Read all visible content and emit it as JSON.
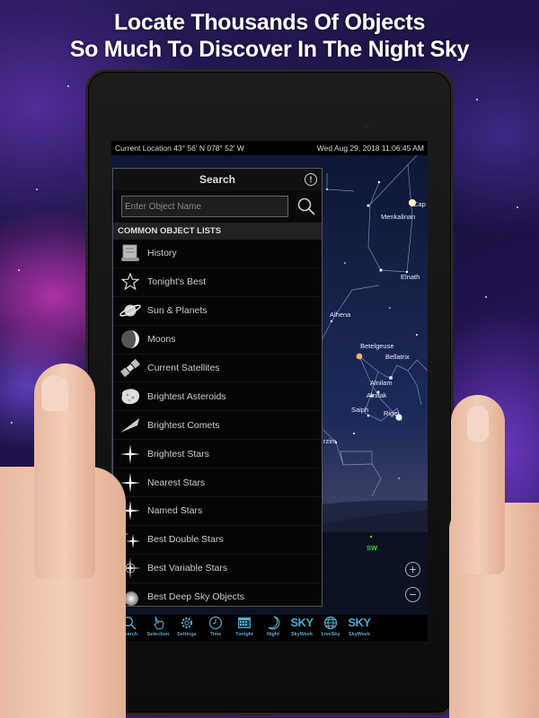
{
  "headline": {
    "line1": "Locate Thousands Of Objects",
    "line2": "So Much To Discover In The Night Sky"
  },
  "statusbar": {
    "location": "Current Location  43° 56' N 078° 52' W",
    "datetime": "Wed Aug 29, 2018  11:06:45 AM"
  },
  "search_panel": {
    "title": "Search",
    "info_icon": "info-icon",
    "input_placeholder": "Enter Object Name",
    "input_value": "",
    "search_icon": "search-icon",
    "section_title": "COMMON OBJECT LISTS",
    "items": [
      {
        "label": "History",
        "icon": "scroll-icon"
      },
      {
        "label": "Tonight's Best",
        "icon": "star-outline-icon"
      },
      {
        "label": "Sun & Planets",
        "icon": "planet-icon"
      },
      {
        "label": "Moons",
        "icon": "moon-icon"
      },
      {
        "label": "Current Satellites",
        "icon": "satellite-icon"
      },
      {
        "label": "Brightest Asteroids",
        "icon": "asteroid-icon"
      },
      {
        "label": "Brightest Comets",
        "icon": "comet-icon"
      },
      {
        "label": "Brightest Stars",
        "icon": "sparkle-star-icon"
      },
      {
        "label": "Nearest Stars",
        "icon": "sparkle-star-icon"
      },
      {
        "label": "Named Stars",
        "icon": "sparkle-star-icon"
      },
      {
        "label": "Best Double Stars",
        "icon": "double-star-icon"
      },
      {
        "label": "Best Variable Stars",
        "icon": "variable-star-icon"
      },
      {
        "label": "Best Deep Sky Objects",
        "icon": "galaxy-icon"
      }
    ]
  },
  "sky": {
    "star_labels": [
      "Cap",
      "Menkalinan",
      "Elnath",
      "Alhena",
      "Betelgeuse",
      "Bellatrix",
      "Alnilam",
      "Alnitak",
      "Saiph",
      "Rigel",
      "rzim"
    ],
    "compass_label": "SW",
    "compass_color": "#3ad43a",
    "zoom_in": "+",
    "zoom_out": "−"
  },
  "toolbar": {
    "accent_color": "#5fa8c8",
    "items": [
      {
        "label": "Search",
        "icon": "search-icon"
      },
      {
        "label": "Selection",
        "icon": "hand-pointer-icon"
      },
      {
        "label": "Settings",
        "icon": "gear-icon"
      },
      {
        "label": "Time",
        "icon": "clock-icon"
      },
      {
        "label": "Tonight",
        "icon": "calendar-icon"
      },
      {
        "label": "Night",
        "icon": "crescent-moon-icon"
      },
      {
        "label": "SkyWeek",
        "icon": "sky-logo-icon",
        "logo_text": "SKY"
      },
      {
        "label": "LiveSky",
        "icon": "globe-icon"
      },
      {
        "label": "SkyWeek",
        "icon": "sky-logo-icon",
        "logo_text": "SKY"
      }
    ]
  }
}
